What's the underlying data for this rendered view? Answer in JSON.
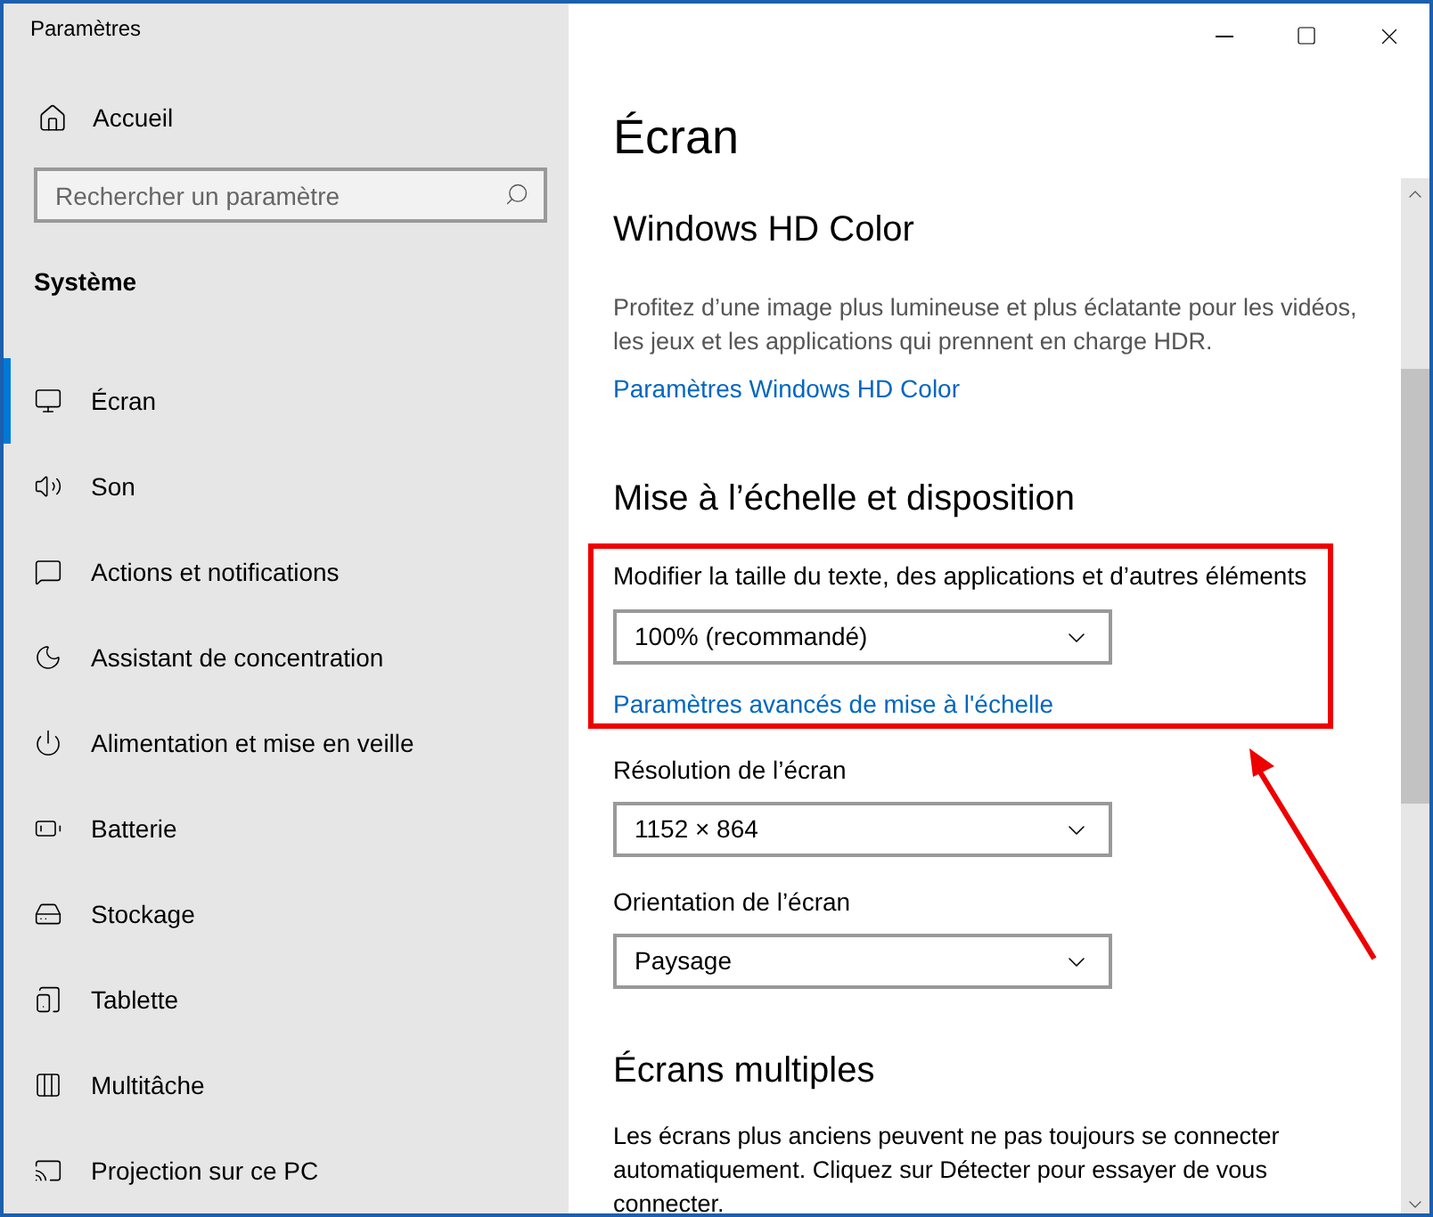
{
  "window": {
    "title": "Paramètres"
  },
  "sidebar": {
    "home": "Accueil",
    "search": {
      "placeholder": "Rechercher un paramètre"
    },
    "section": "Système",
    "items": [
      {
        "label": "Écran",
        "selected": true
      },
      {
        "label": "Son",
        "selected": false
      },
      {
        "label": "Actions et notifications",
        "selected": false
      },
      {
        "label": "Assistant de concentration",
        "selected": false
      },
      {
        "label": "Alimentation et mise en veille",
        "selected": false
      },
      {
        "label": "Batterie",
        "selected": false
      },
      {
        "label": "Stockage",
        "selected": false
      },
      {
        "label": "Tablette",
        "selected": false
      },
      {
        "label": "Multitâche",
        "selected": false
      },
      {
        "label": "Projection sur ce PC",
        "selected": false
      }
    ]
  },
  "page": {
    "title": "Écran",
    "hd_color": {
      "heading": "Windows HD Color",
      "text": "Profitez d’une image plus lumineuse et plus éclatante pour les vidéos, les jeux et les applications qui prennent en charge HDR.",
      "link": "Paramètres Windows HD Color"
    },
    "scale": {
      "heading": "Mise à l’échelle et disposition",
      "scale_label": "Modifier la taille du texte, des applications et d’autres éléments",
      "scale_value": "100% (recommandé)",
      "advanced_link": "Paramètres avancés de mise à l'échelle",
      "resolution_label": "Résolution de l’écran",
      "resolution_value": "1152 × 864",
      "orientation_label": "Orientation de l’écran",
      "orientation_value": "Paysage"
    },
    "multi": {
      "heading": "Écrans multiples",
      "text": "Les écrans plus anciens peuvent ne pas toujours se connecter automatiquement. Cliquez sur Détecter pour essayer de vous connecter."
    }
  }
}
